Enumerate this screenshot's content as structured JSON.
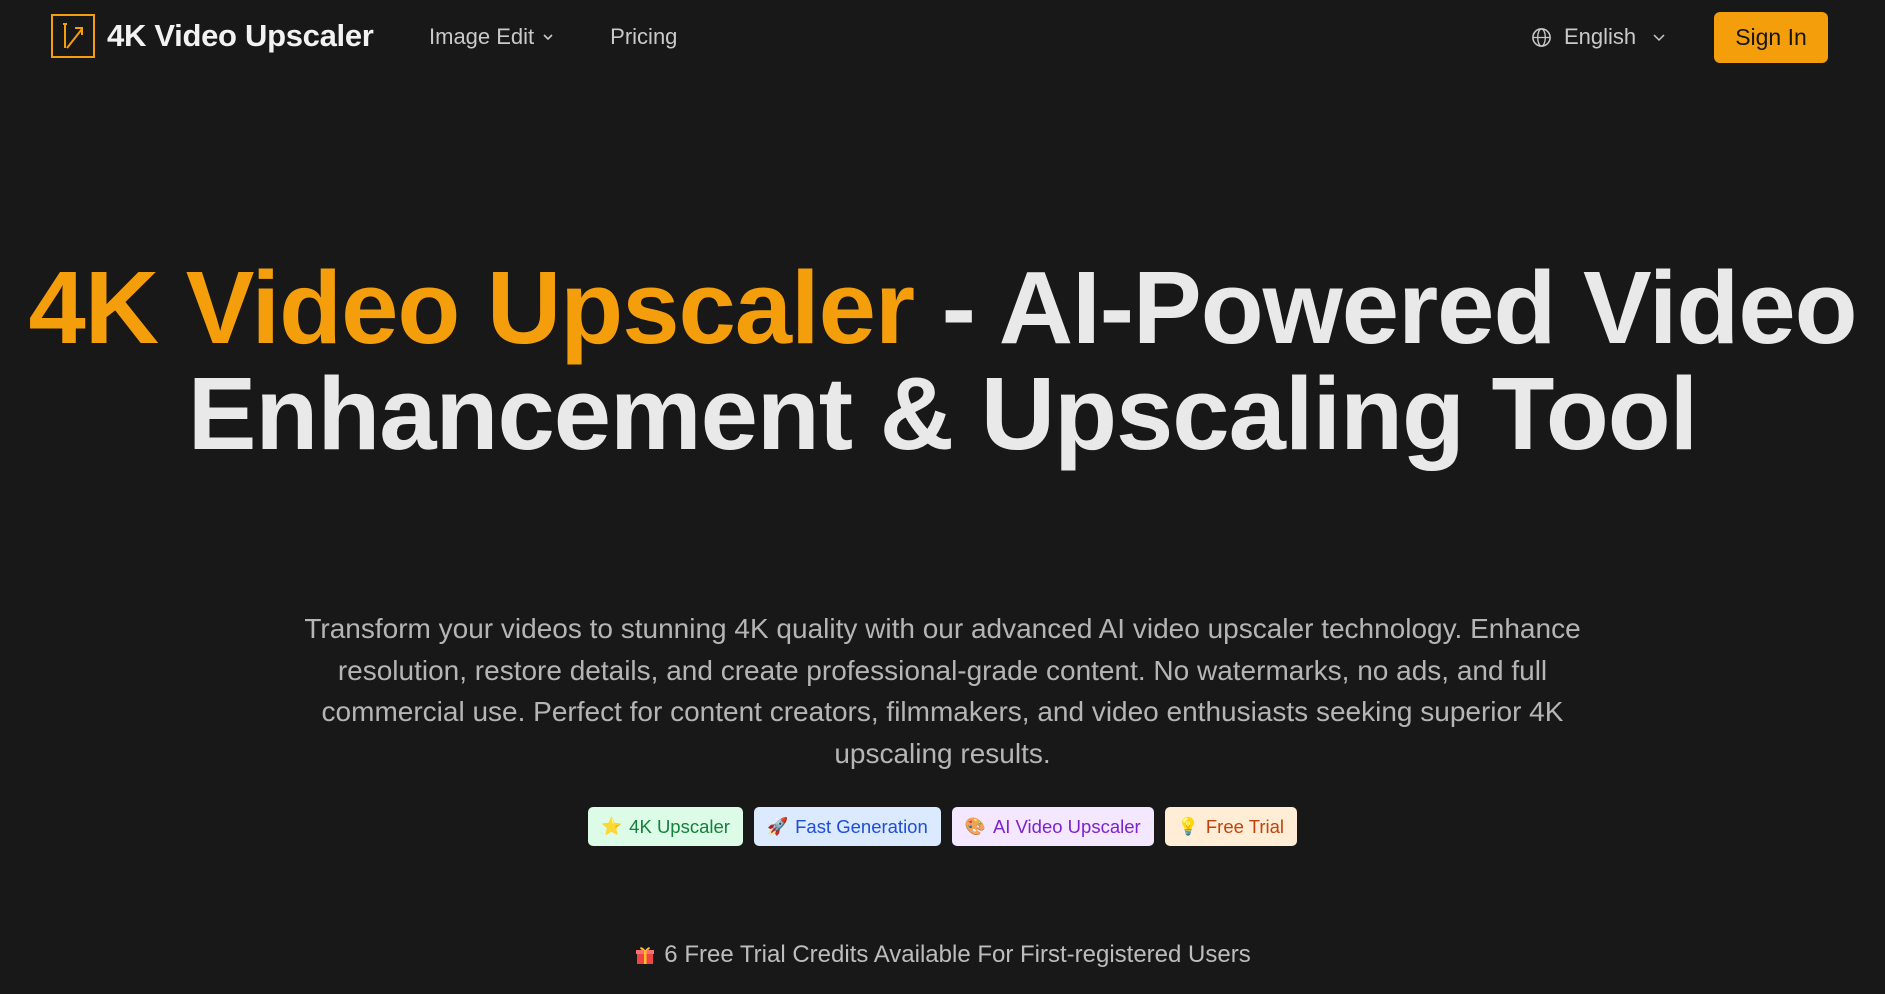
{
  "header": {
    "brand_name": "4K Video Upscaler",
    "nav": [
      {
        "label": "Image Edit",
        "has_dropdown": true
      },
      {
        "label": "Pricing",
        "has_dropdown": false
      }
    ],
    "language": "English",
    "signin_label": "Sign In"
  },
  "hero": {
    "title_accent": "4K Video Upscaler",
    "title_rest": " - AI-Powered Video Enhancement & Upscaling Tool",
    "description": "Transform your videos to stunning 4K quality with our advanced AI video upscaler technology. Enhance resolution, restore details, and create professional-grade content. No watermarks, no ads, and full commercial use. Perfect for content creators, filmmakers, and video enthusiasts seeking superior 4K upscaling results.",
    "tags": [
      {
        "emoji": "⭐",
        "label": "4K Upscaler"
      },
      {
        "emoji": "🚀",
        "label": "Fast Generation"
      },
      {
        "emoji": "🎨",
        "label": "AI Video Upscaler"
      },
      {
        "emoji": "💡",
        "label": "Free Trial"
      }
    ],
    "trial_text": "6 Free Trial Credits Available For First-registered Users"
  },
  "colors": {
    "background": "#181818",
    "accent": "#f59e0b",
    "heading": "#e9e9e9",
    "body_text": "#b5b5b5"
  }
}
